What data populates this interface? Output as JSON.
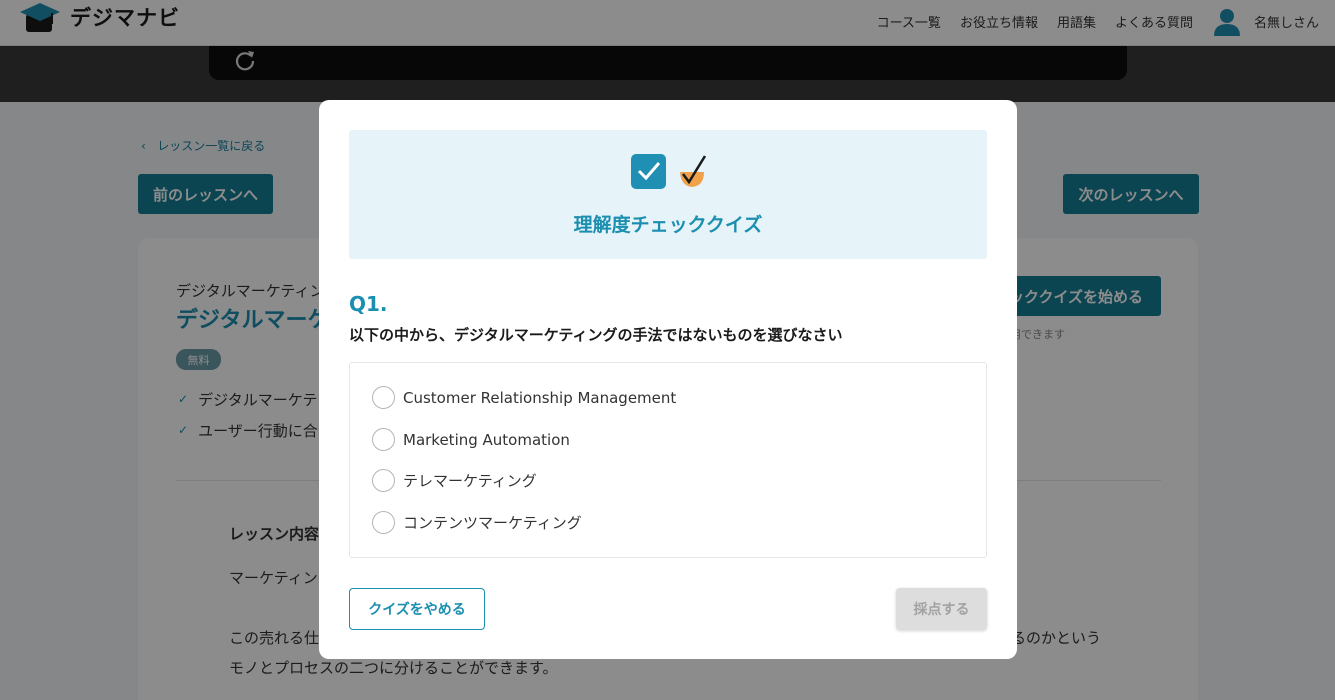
{
  "header": {
    "logo_text": "デジマナビ",
    "nav": [
      "コース一覧",
      "お役立ち情報",
      "用語集",
      "よくある質問"
    ],
    "user_name": "名無しさん"
  },
  "page": {
    "back_link": "レッスン一覧に戻る",
    "prev_button": "前のレッスンへ",
    "next_button": "次のレッスンへ",
    "course_subtitle": "デジタルマーケティン",
    "course_title": "デジタルマーケ",
    "badge": "無料",
    "checklist": [
      "デジタルマーケテ",
      "ユーザー行動に合"
    ],
    "start_button": "ッククイズを始める",
    "start_note": "用できます",
    "lesson_heading": "レッスン内容",
    "para1": "マーケティン",
    "para2a": "この売れる仕",
    "para2a_tail": "るのかという",
    "para2b": "モノとプロセスの二つに分けることができます。"
  },
  "modal": {
    "title": "理解度チェッククイズ",
    "question_number": "Q1.",
    "question_text": "以下の中から、デジタルマーケティングの手法ではないものを選びなさい",
    "options": [
      "Customer Relationship Management",
      "Marketing Automation",
      "テレマーケティング",
      "コンテンツマーケティング"
    ],
    "quit_button": "クイズをやめる",
    "grade_button": "採点する"
  },
  "colors": {
    "brand": "#1b8fb0",
    "button_teal": "#167e96",
    "banner_bg": "#e6f3f8"
  }
}
